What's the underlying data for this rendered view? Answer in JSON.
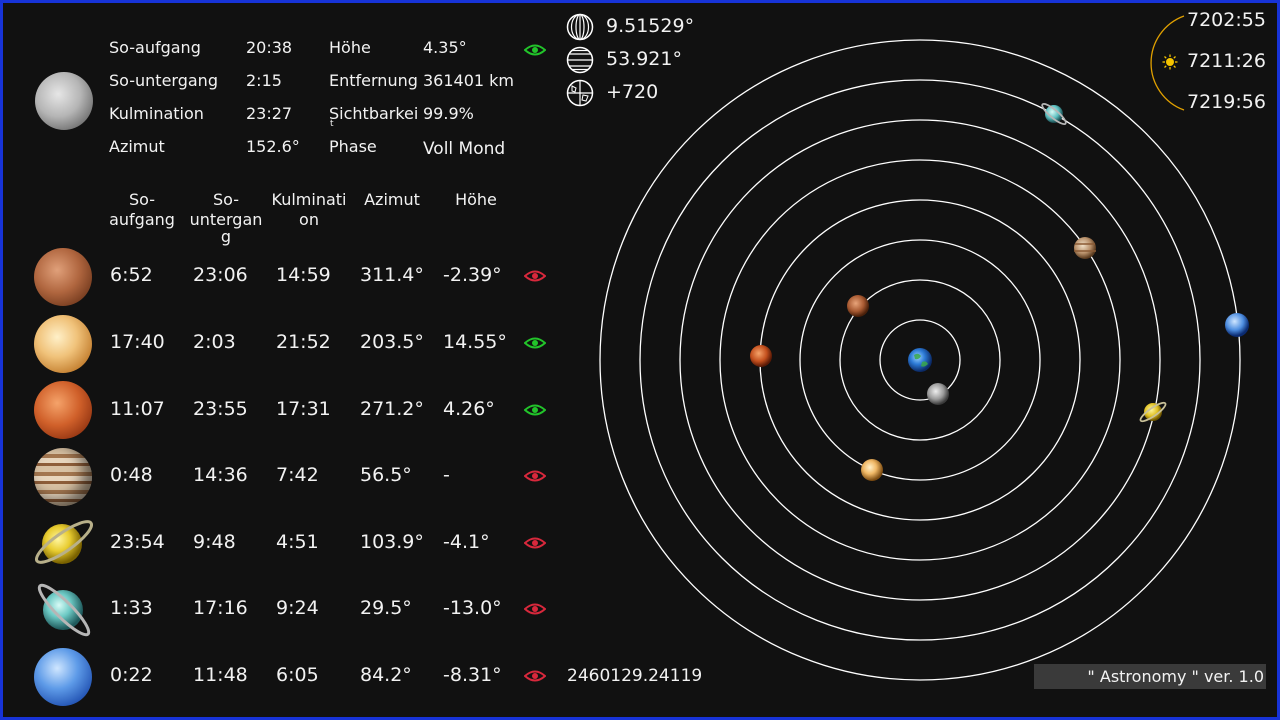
{
  "moon": {
    "icon": "moon-icon",
    "rows": [
      {
        "label": "So-aufgang",
        "value": "20:38",
        "label2": "Höhe",
        "value2": "4.35°"
      },
      {
        "label": "So-untergang",
        "value": "2:15",
        "label2": "Entfernung",
        "value2": "361401 km"
      },
      {
        "label": "Kulmination",
        "value": "23:27",
        "label2": "Sichtbarkei",
        "label2_wrap": "t",
        "value2": "99.9%"
      },
      {
        "label": "Azimut",
        "value": "152.6°",
        "label2": "Phase",
        "value2": "Voll Mond"
      }
    ],
    "visible": true
  },
  "table_headers": [
    {
      "l1": "So-",
      "l2": "aufgang",
      "l3": ""
    },
    {
      "l1": "So-",
      "l2": "untergan",
      "l3": "g"
    },
    {
      "l1": "Kulminati",
      "l2": "on",
      "l3": ""
    },
    {
      "l1": "Azimut",
      "l2": "",
      "l3": ""
    },
    {
      "l1": "Höhe",
      "l2": "",
      "l3": ""
    }
  ],
  "planets": [
    {
      "name_icon": "mercury-icon",
      "rise": "6:52",
      "set": "23:06",
      "culm": "14:59",
      "azimuth": "311.4°",
      "altitude": "-2.39°",
      "visible": false
    },
    {
      "name_icon": "venus-icon",
      "rise": "17:40",
      "set": "2:03",
      "culm": "21:52",
      "azimuth": "203.5°",
      "altitude": "14.55°",
      "visible": true
    },
    {
      "name_icon": "mars-icon",
      "rise": "11:07",
      "set": "23:55",
      "culm": "17:31",
      "azimuth": "271.2°",
      "altitude": "4.26°",
      "visible": true
    },
    {
      "name_icon": "jupiter-icon",
      "rise": "0:48",
      "set": "14:36",
      "culm": "7:42",
      "azimuth": "56.5°",
      "altitude": "-",
      "visible": false
    },
    {
      "name_icon": "saturn-icon",
      "rise": "23:54",
      "set": "9:48",
      "culm": "4:51",
      "azimuth": "103.9°",
      "altitude": "-4.1°",
      "visible": false
    },
    {
      "name_icon": "uranus-icon",
      "rise": "1:33",
      "set": "17:16",
      "culm": "9:24",
      "azimuth": "29.5°",
      "altitude": "-13.0°",
      "visible": false
    },
    {
      "name_icon": "neptune-icon",
      "rise": "0:22",
      "set": "11:48",
      "culm": "6:05",
      "azimuth": "84.2°",
      "altitude": "-8.31°",
      "visible": false
    }
  ],
  "location": {
    "longitude": "9.51529°",
    "latitude": "53.921°",
    "timezone": "+720"
  },
  "julian_date": "2460129.24119",
  "sun_times": {
    "top": "7202:55",
    "middle": "7211:26",
    "bottom": "7219:56"
  },
  "version": "\" Astronomy \" ver. 1.0",
  "colors": {
    "visible_eye": "#22c42a",
    "hidden_eye": "#d8283c",
    "frame": "#1733d8",
    "orbit": "#ffffff",
    "sun_arc": "#e0a000"
  }
}
